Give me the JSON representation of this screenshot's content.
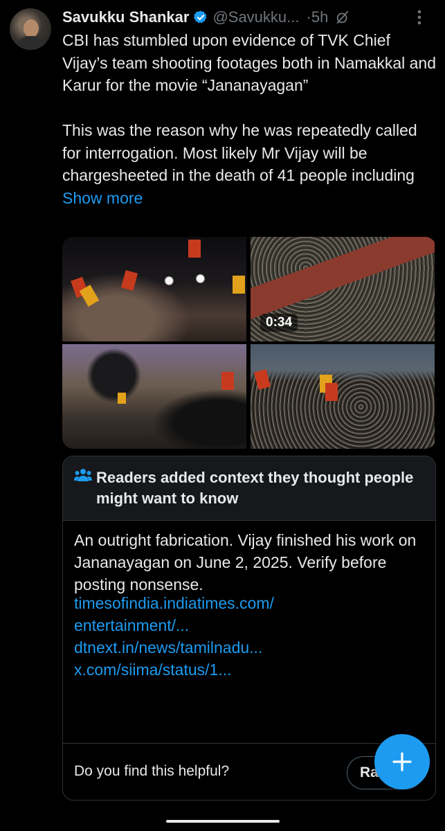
{
  "tweet": {
    "author_name": "Savukku Shankar",
    "handle": "@Savukku...",
    "separator": "·",
    "time": "5h",
    "text": "CBI has stumbled upon evidence of TVK Chief Vijay’s team shooting footages both in Namakkal and Karur for the movie “Jananayagan”\n\nThis was the reason why he was repeatedly called for interrogation.   Most likely Mr Vijay will be chargesheeted in the death of 41 people including ",
    "show_more": "Show more",
    "video_duration": "0:34"
  },
  "icons": {
    "verified": "verified-badge-icon",
    "grok": "grok-icon",
    "more": "more-options-icon",
    "note": "readers-people-icon",
    "compose": "plus-icon"
  },
  "community_note": {
    "title": "Readers added context they thought people might want to know",
    "body": "An outright fabrication. Vijay finished his work on Jananayagan on June 2, 2025. Verify before posting nonsense.",
    "links": [
      "timesofindia.indiatimes.com/",
      "entertainment/...",
      "dtnext.in/news/tamilnadu...",
      "x.com/siima/status/1..."
    ],
    "helpful_question": "Do you find this helpful?",
    "rate_label": "Ra"
  },
  "colors": {
    "background": "#000000",
    "text": "#e7e9ea",
    "secondary": "#71767b",
    "accent": "#1d9bf0",
    "note_header": "#16181c",
    "border": "#2f3336"
  }
}
